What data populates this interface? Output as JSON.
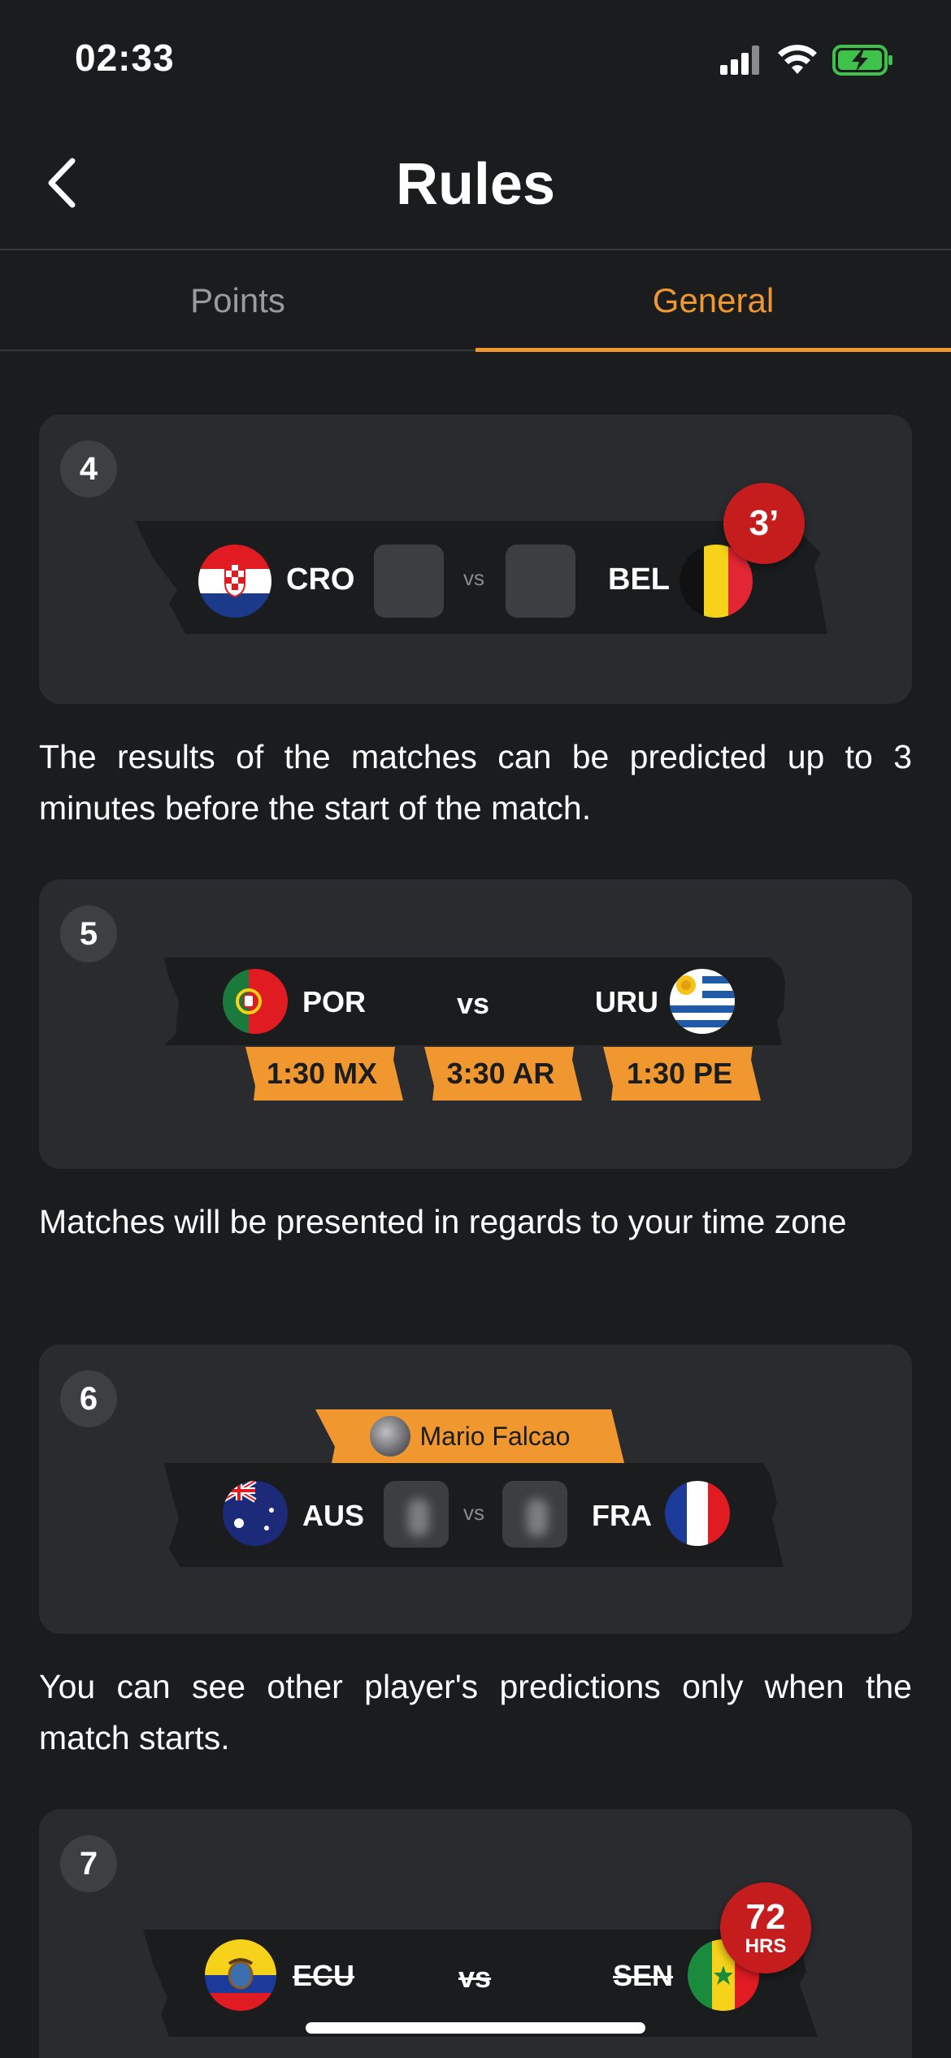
{
  "status_bar": {
    "time": "02:33"
  },
  "header": {
    "title": "Rules"
  },
  "tabs": [
    {
      "label": "Points",
      "active": false
    },
    {
      "label": "General",
      "active": true
    }
  ],
  "colors": {
    "accent": "#f0982f",
    "badge": "#c51d1d",
    "card": "#2a2b2e",
    "background": "#1b1c1e"
  },
  "rules": [
    {
      "number": "4",
      "home": "CRO",
      "away": "BEL",
      "vs": "vs",
      "badge": "3’",
      "text": "The results of the matches can be predicted up to 3 minutes before the start of the match."
    },
    {
      "number": "5",
      "home": "POR",
      "away": "URU",
      "vs": "vs",
      "times": [
        "1:30 MX",
        "3:30 AR",
        "1:30 PE"
      ],
      "text": "Matches will be presented in regards to your time zone"
    },
    {
      "number": "6",
      "player": "Mario Falcao",
      "home": "AUS",
      "away": "FRA",
      "vs": "vs",
      "text": "You can see other player's predictions only when the match starts."
    },
    {
      "number": "7",
      "home": "ECU",
      "away": "SEN",
      "vs": "vs",
      "badge_value": "72",
      "badge_unit": "HRS"
    }
  ]
}
